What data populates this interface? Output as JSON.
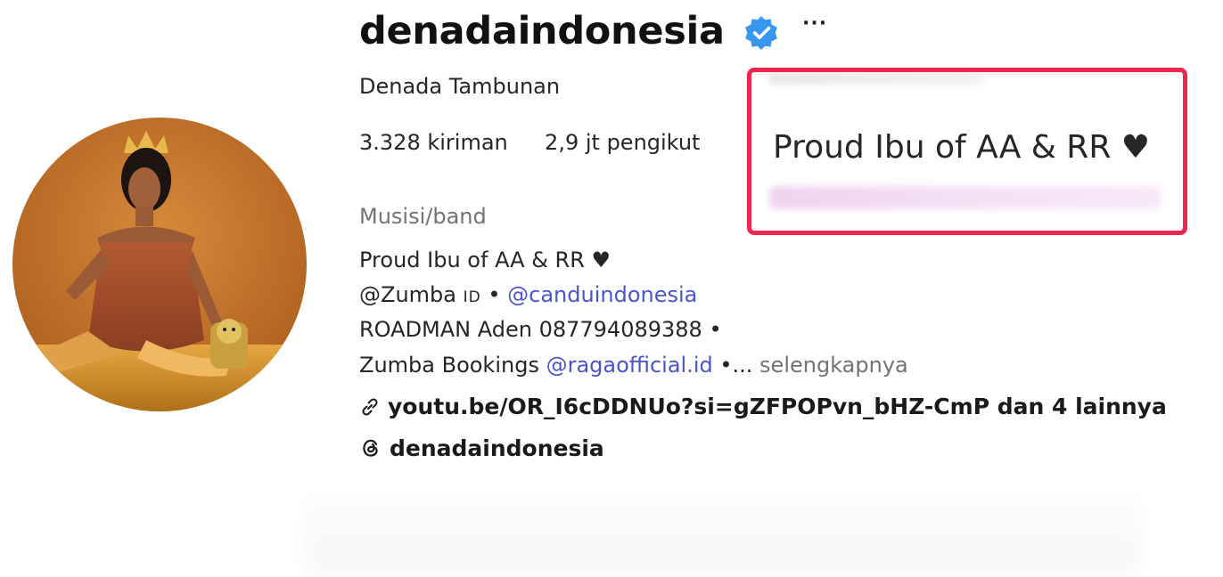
{
  "profile": {
    "username": "denadaindonesia",
    "more_label": "···",
    "full_name": "Denada Tambunan",
    "stats": {
      "posts_value": "3.328",
      "posts_label": "kiriman",
      "followers_value": "2,9 jt",
      "followers_label": "pengikut"
    },
    "category": "Musisi/band",
    "bio": {
      "line1": "Proud Ibu of AA & RR ♥",
      "line2_prefix": "@Zumba ",
      "line2_smallcaps": "ID",
      "line2_sep": " • ",
      "line2_link": "@canduindonesia",
      "line3": "ROADMAN Aden 087794089388 •",
      "line4_prefix": "Zumba Bookings ",
      "line4_link": "@ragaofficial.id",
      "line4_suffix": " •...",
      "more_link": " selengkapnya"
    },
    "website": "youtu.be/OR_I6cDDNUo?si=gZFPOPvn_bHZ-CmP dan 4 lainnya",
    "threads_handle": "denadaindonesia"
  },
  "highlight_box": {
    "text": "Proud Ibu of AA & RR ♥",
    "border_color": "#f0264f"
  },
  "colors": {
    "link": "#4a55c9",
    "verified_badge": "#3897f0",
    "muted": "#737373"
  }
}
